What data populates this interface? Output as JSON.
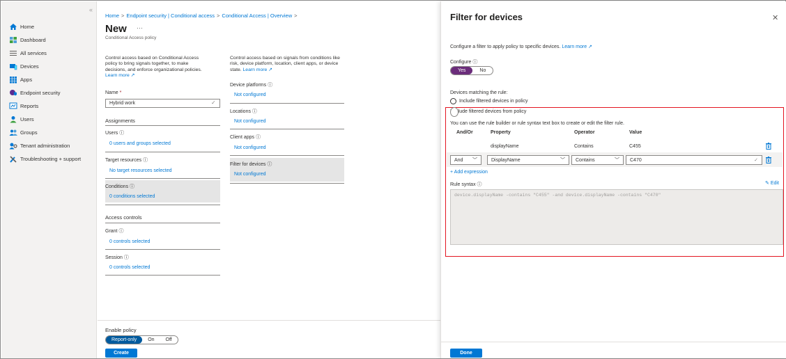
{
  "sidebar": {
    "collapse_glyph": "«",
    "items": [
      {
        "label": "Home",
        "icon": "home-icon"
      },
      {
        "label": "Dashboard",
        "icon": "dashboard-icon"
      },
      {
        "label": "All services",
        "icon": "all-services-icon"
      },
      {
        "label": "Devices",
        "icon": "devices-icon"
      },
      {
        "label": "Apps",
        "icon": "apps-icon"
      },
      {
        "label": "Endpoint security",
        "icon": "endpoint-security-icon"
      },
      {
        "label": "Reports",
        "icon": "reports-icon"
      },
      {
        "label": "Users",
        "icon": "users-icon"
      },
      {
        "label": "Groups",
        "icon": "groups-icon"
      },
      {
        "label": "Tenant administration",
        "icon": "tenant-admin-icon"
      },
      {
        "label": "Troubleshooting + support",
        "icon": "troubleshooting-icon"
      }
    ]
  },
  "breadcrumb": {
    "items": [
      "Home",
      "Endpoint security | Conditional access",
      "Conditional Access | Overview"
    ],
    "sep": ">"
  },
  "policy": {
    "title": "New",
    "more": "···",
    "subtitle": "Conditional Access policy",
    "left_desc": "Control access based on Conditional Access policy to bring signals together, to make decisions, and enforce organizational policies.",
    "learn_more": "Learn more",
    "name_label": "Name",
    "name_required": "*",
    "name_value": "Hybrid work",
    "assignments": "Assignments",
    "users_label": "Users",
    "users_value": "0 users and groups selected",
    "target_label": "Target resources",
    "target_value": "No target resources selected",
    "conditions_label": "Conditions",
    "conditions_value": "0 conditions selected",
    "access_controls": "Access controls",
    "grant_label": "Grant",
    "grant_value": "0 controls selected",
    "session_label": "Session",
    "session_value": "0 controls selected",
    "right_desc": "Control access based on signals from conditions like risk, device platform, location, client apps, or device state.",
    "right_learn_more": "Learn more",
    "device_platforms_label": "Device platforms",
    "device_platforms_value": "Not configured",
    "locations_label": "Locations",
    "locations_value": "Not configured",
    "client_apps_label": "Client apps",
    "client_apps_value": "Not configured",
    "filter_label": "Filter for devices",
    "filter_value": "Not configured",
    "enable_label": "Enable policy",
    "enable_options": [
      "Report-only",
      "On",
      "Off"
    ],
    "enable_selected": "Report-only",
    "create_button": "Create"
  },
  "panel": {
    "title": "Filter for devices",
    "close": "✕",
    "desc": "Configure a filter to apply policy to specific devices.",
    "learn_more": "Learn more",
    "configure_label": "Configure",
    "configure_options": [
      "Yes",
      "No"
    ],
    "configure_selected": "Yes",
    "matching_label": "Devices matching the rule:",
    "include_label": "Include filtered devices in policy",
    "exclude_label": "Exclude filtered devices from policy",
    "selected_mode": "exclude",
    "builder_hint": "You can use the rule builder or rule syntax text box to create or edit the filter rule.",
    "columns": [
      "And/Or",
      "Property",
      "Operator",
      "Value"
    ],
    "row1": {
      "property": "displayName",
      "operator": "Contains",
      "value": "C455"
    },
    "row2": {
      "andor": "And",
      "property": "DisplayName",
      "operator": "Contains",
      "value": "C470"
    },
    "add_expression": "+ Add expression",
    "rule_syntax_label": "Rule syntax",
    "edit_label": "Edit",
    "rule_syntax_value": "device.displayName -contains \"C455\" -and device.displayName -contains \"C470\"",
    "done_button": "Done"
  },
  "colors": {
    "accent": "#0078d4",
    "toggle_purple": "#6b2d7b",
    "highlight_border": "#e3131f"
  }
}
